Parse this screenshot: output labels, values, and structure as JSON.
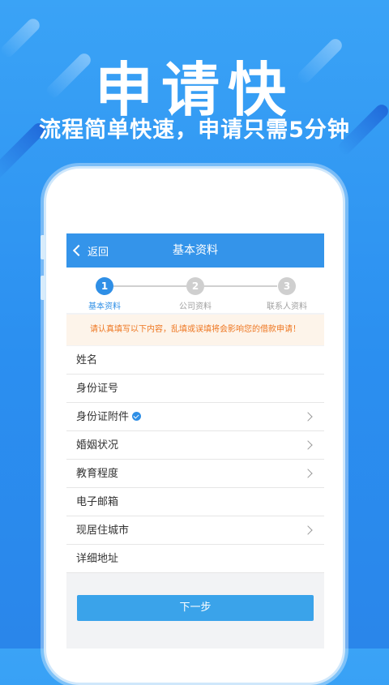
{
  "banner": {
    "headline": "申请快",
    "subline": "流程简单快速，申请只需5分钟"
  },
  "app": {
    "navbar": {
      "back_label": "返回",
      "title": "基本资料"
    },
    "steps": [
      {
        "number": "1",
        "label": "基本资料",
        "active": true
      },
      {
        "number": "2",
        "label": "公司资料",
        "active": false
      },
      {
        "number": "3",
        "label": "联系人资料",
        "active": false
      }
    ],
    "notice": "请认真填写以下内容，乱填或误填将会影响您的借款申请！",
    "form_rows": [
      {
        "label": "姓名",
        "has_arrow": false,
        "verified": false
      },
      {
        "label": "身份证号",
        "has_arrow": false,
        "verified": false
      },
      {
        "label": "身份证附件",
        "has_arrow": true,
        "verified": true
      },
      {
        "label": "婚姻状况",
        "has_arrow": true,
        "verified": false
      },
      {
        "label": "教育程度",
        "has_arrow": true,
        "verified": false
      },
      {
        "label": "电子邮箱",
        "has_arrow": false,
        "verified": false
      },
      {
        "label": "现居住城市",
        "has_arrow": true,
        "verified": false
      },
      {
        "label": "详细地址",
        "has_arrow": false,
        "verified": false
      }
    ],
    "next_button": "下一步"
  },
  "colors": {
    "background": "#2b8ff0",
    "accent": "#3494ea",
    "notice_text": "#ee7722"
  }
}
